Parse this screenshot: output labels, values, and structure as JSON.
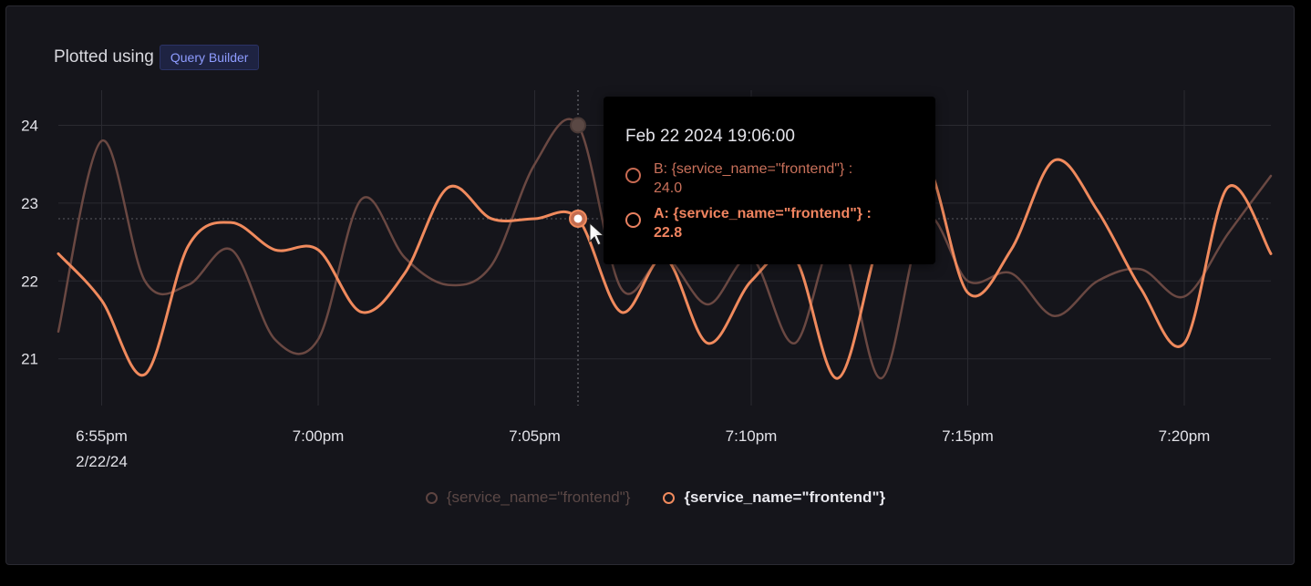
{
  "panel": {
    "title": "Plotted using",
    "badge": "Query Builder"
  },
  "tooltip": {
    "time": "Feb 22 2024 19:06:00",
    "rows": [
      {
        "label": "B: {service_name=\"frontend\"} :",
        "value": "24.0"
      },
      {
        "label": "A: {service_name=\"frontend\"} :",
        "value": "22.8"
      }
    ]
  },
  "legend": {
    "items": [
      {
        "label": "{service_name=\"frontend\"}",
        "state": "dimmed"
      },
      {
        "label": "{service_name=\"frontend\"}",
        "state": "active"
      }
    ]
  },
  "colors": {
    "background": "#15151b",
    "series_a": "#f08a5d",
    "series_b": "#6a4842",
    "badge_text": "#8e9cff"
  },
  "chart_data": {
    "type": "line",
    "x_unit": "minutes",
    "x_ticks": [
      {
        "x": "18:55",
        "label": "6:55pm",
        "sublabel": "2/22/24"
      },
      {
        "x": "19:00",
        "label": "7:00pm"
      },
      {
        "x": "19:05",
        "label": "7:05pm"
      },
      {
        "x": "19:10",
        "label": "7:10pm"
      },
      {
        "x": "19:15",
        "label": "7:15pm"
      },
      {
        "x": "19:20",
        "label": "7:20pm"
      }
    ],
    "y_ticks": [
      21,
      22,
      23,
      24
    ],
    "xlim": [
      "18:54",
      "19:22"
    ],
    "ylim": [
      20.4,
      24.45
    ],
    "grid": true,
    "legend_position": "bottom",
    "hover_x": "19:06",
    "series": [
      {
        "id": "B",
        "state": "dimmed",
        "points": [
          [
            "18:54",
            21.35
          ],
          [
            "18:55",
            23.8
          ],
          [
            "18:56",
            22.0
          ],
          [
            "18:57",
            21.95
          ],
          [
            "18:58",
            22.4
          ],
          [
            "18:59",
            21.25
          ],
          [
            "19:00",
            21.25
          ],
          [
            "19:01",
            23.05
          ],
          [
            "19:02",
            22.3
          ],
          [
            "19:03",
            21.95
          ],
          [
            "19:04",
            22.2
          ],
          [
            "19:05",
            23.5
          ],
          [
            "19:06",
            24.0
          ],
          [
            "19:07",
            21.9
          ],
          [
            "19:08",
            22.3
          ],
          [
            "19:09",
            21.7
          ],
          [
            "19:10",
            22.3
          ],
          [
            "19:11",
            21.2
          ],
          [
            "19:12",
            22.6
          ],
          [
            "19:13",
            20.75
          ],
          [
            "19:14",
            22.8
          ],
          [
            "19:15",
            22.0
          ],
          [
            "19:16",
            22.1
          ],
          [
            "19:17",
            21.55
          ],
          [
            "19:18",
            22.0
          ],
          [
            "19:19",
            22.15
          ],
          [
            "19:20",
            21.8
          ],
          [
            "19:21",
            22.6
          ],
          [
            "19:22",
            23.35
          ]
        ]
      },
      {
        "id": "A",
        "state": "active",
        "points": [
          [
            "18:54",
            22.35
          ],
          [
            "18:55",
            21.75
          ],
          [
            "18:56",
            20.8
          ],
          [
            "18:57",
            22.45
          ],
          [
            "18:58",
            22.75
          ],
          [
            "18:59",
            22.4
          ],
          [
            "19:00",
            22.4
          ],
          [
            "19:01",
            21.6
          ],
          [
            "19:02",
            22.1
          ],
          [
            "19:03",
            23.2
          ],
          [
            "19:04",
            22.8
          ],
          [
            "19:05",
            22.8
          ],
          [
            "19:06",
            22.8
          ],
          [
            "19:07",
            21.6
          ],
          [
            "19:08",
            22.3
          ],
          [
            "19:09",
            21.2
          ],
          [
            "19:10",
            22.0
          ],
          [
            "19:11",
            22.3
          ],
          [
            "19:12",
            20.75
          ],
          [
            "19:13",
            22.6
          ],
          [
            "19:14",
            23.55
          ],
          [
            "19:15",
            21.85
          ],
          [
            "19:16",
            22.4
          ],
          [
            "19:17",
            23.55
          ],
          [
            "19:18",
            22.9
          ],
          [
            "19:19",
            21.9
          ],
          [
            "19:20",
            21.2
          ],
          [
            "19:21",
            23.2
          ],
          [
            "19:22",
            22.35
          ]
        ]
      }
    ]
  }
}
